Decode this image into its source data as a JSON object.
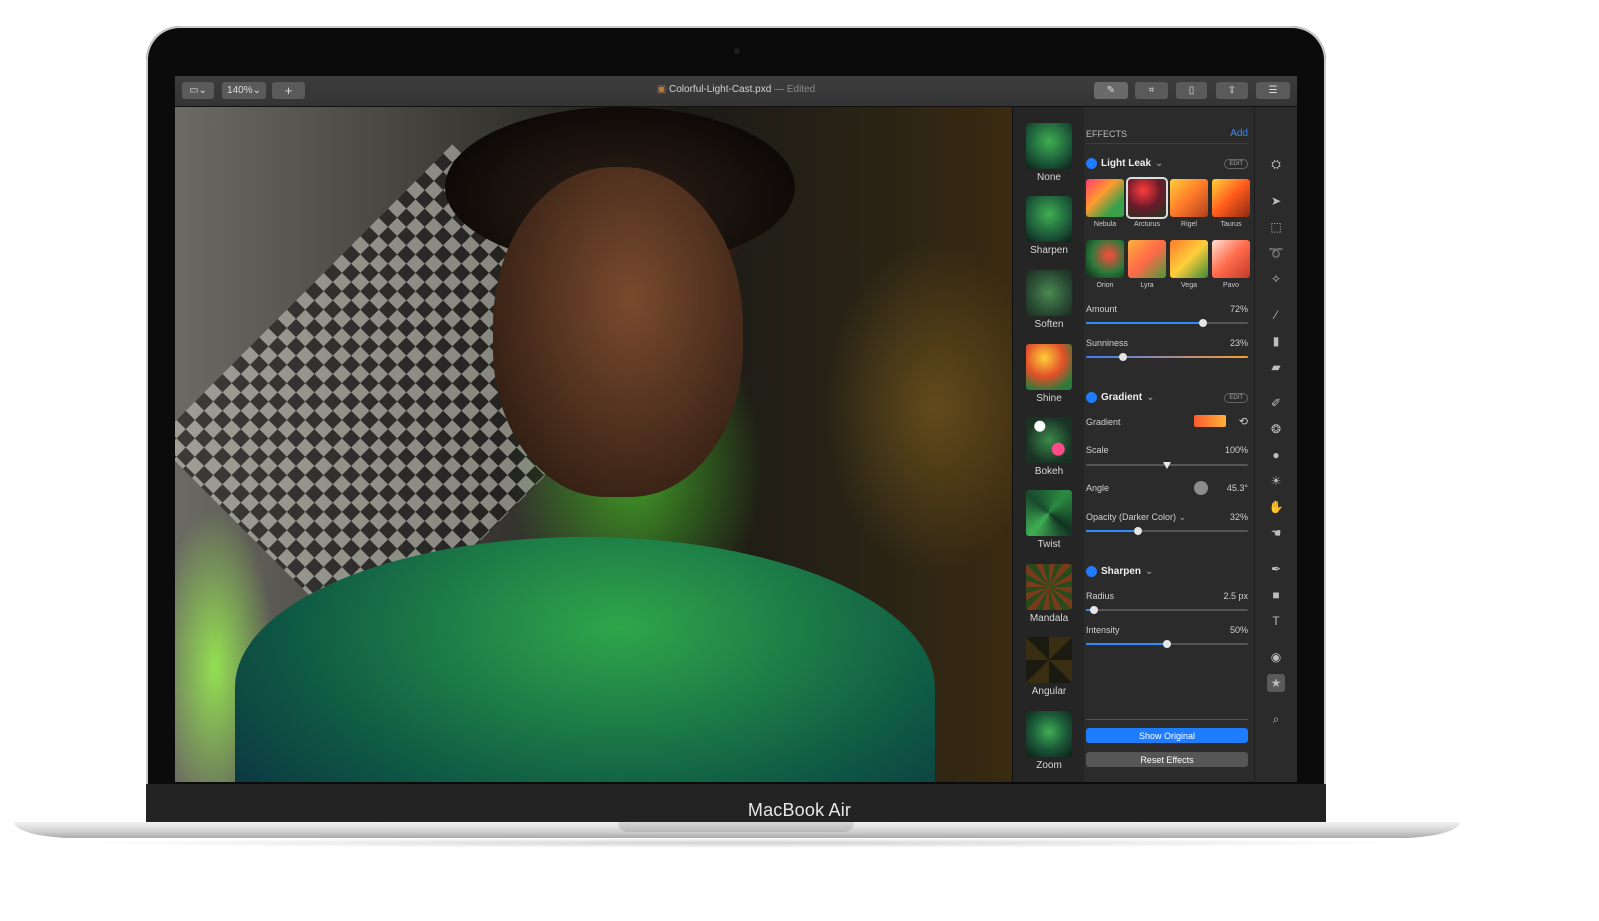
{
  "device": {
    "label": "MacBook Air"
  },
  "toolbar": {
    "view_icon": "sidebar-icon",
    "zoom": "140%",
    "add_label": "+",
    "title": "Colorful-Light-Cast.pxd",
    "title_suffix": "— Edited"
  },
  "effects_browser": {
    "items": [
      {
        "label": "None"
      },
      {
        "label": "Sharpen"
      },
      {
        "label": "Soften"
      },
      {
        "label": "Shine"
      },
      {
        "label": "Bokeh"
      },
      {
        "label": "Twist"
      },
      {
        "label": "Mandala"
      },
      {
        "label": "Angular"
      },
      {
        "label": "Zoom"
      }
    ]
  },
  "panel": {
    "header": "EFFECTS",
    "add_label": "Add",
    "light_leak": {
      "title": "Light Leak",
      "edit_label": "EDIT",
      "presets": [
        "Nebula",
        "Arcturus",
        "Rigel",
        "Taurus",
        "Orion",
        "Lyra",
        "Vega",
        "Pavo"
      ],
      "selected": "Arcturus",
      "amount": {
        "label": "Amount",
        "value": "72%",
        "fraction": 0.72
      },
      "sunniness": {
        "label": "Sunniness",
        "value": "23%",
        "fraction": 0.23
      }
    },
    "gradient": {
      "title": "Gradient",
      "edit_label": "EDIT",
      "gradient_label": "Gradient",
      "scale": {
        "label": "Scale",
        "value": "100%",
        "fraction": 0.5
      },
      "angle": {
        "label": "Angle",
        "value": "45.3°"
      },
      "opacity": {
        "label": "Opacity (Darker Color)",
        "value": "32%",
        "fraction": 0.32
      }
    },
    "sharpen": {
      "title": "Sharpen",
      "radius": {
        "label": "Radius",
        "value": "2.5 px",
        "fraction": 0.05
      },
      "intensity": {
        "label": "Intensity",
        "value": "50%",
        "fraction": 0.5
      }
    },
    "show_original": "Show Original",
    "reset_effects": "Reset Effects"
  },
  "colors": {
    "accent": "#1e7cff",
    "panel_bg": "#2b2b2b"
  }
}
